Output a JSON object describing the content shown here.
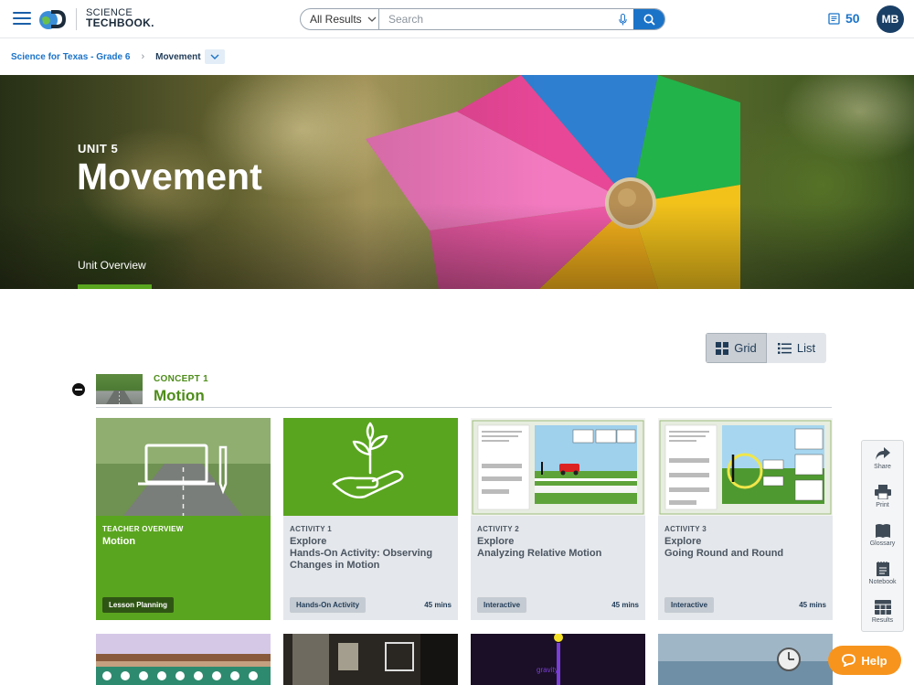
{
  "header": {
    "logo_line1": "SCIENCE",
    "logo_line2": "TECHBOOK.",
    "search_scope": "All Results",
    "search_placeholder": "Search",
    "points": "50",
    "avatar_initials": "MB"
  },
  "breadcrumb": {
    "parent": "Science for Texas - Grade 6",
    "current": "Movement"
  },
  "hero": {
    "unit_label": "UNIT 5",
    "title": "Movement",
    "tab": "Unit Overview"
  },
  "view_toggle": {
    "grid_label": "Grid",
    "list_label": "List",
    "selected": "Grid"
  },
  "concept": {
    "label": "CONCEPT 1",
    "title": "Motion"
  },
  "cards": [
    {
      "kicker": "TEACHER OVERVIEW",
      "title": "Motion",
      "tag": "Lesson Planning",
      "duration": ""
    },
    {
      "kicker": "ACTIVITY 1",
      "title": "Explore\nHands-On Activity: Observing Changes in Motion",
      "tag": "Hands-On Activity",
      "duration": "45 mins"
    },
    {
      "kicker": "ACTIVITY 2",
      "title": "Explore\nAnalyzing Relative Motion",
      "tag": "Interactive",
      "duration": "45 mins"
    },
    {
      "kicker": "ACTIVITY 3",
      "title": "Explore\nGoing Round and Round",
      "tag": "Interactive",
      "duration": "45 mins"
    }
  ],
  "sidetools": [
    {
      "label": "Share",
      "icon": "share-icon"
    },
    {
      "label": "Print",
      "icon": "print-icon"
    },
    {
      "label": "Glossary",
      "icon": "book-icon"
    },
    {
      "label": "Notebook",
      "icon": "notebook-icon"
    },
    {
      "label": "Results",
      "icon": "grid-icon"
    }
  ],
  "help_label": "Help",
  "colors": {
    "brand_blue": "#1b73c8",
    "concept_green": "#4e8d1a",
    "teacher_green": "#5aa51f",
    "help_orange": "#f7941d"
  }
}
